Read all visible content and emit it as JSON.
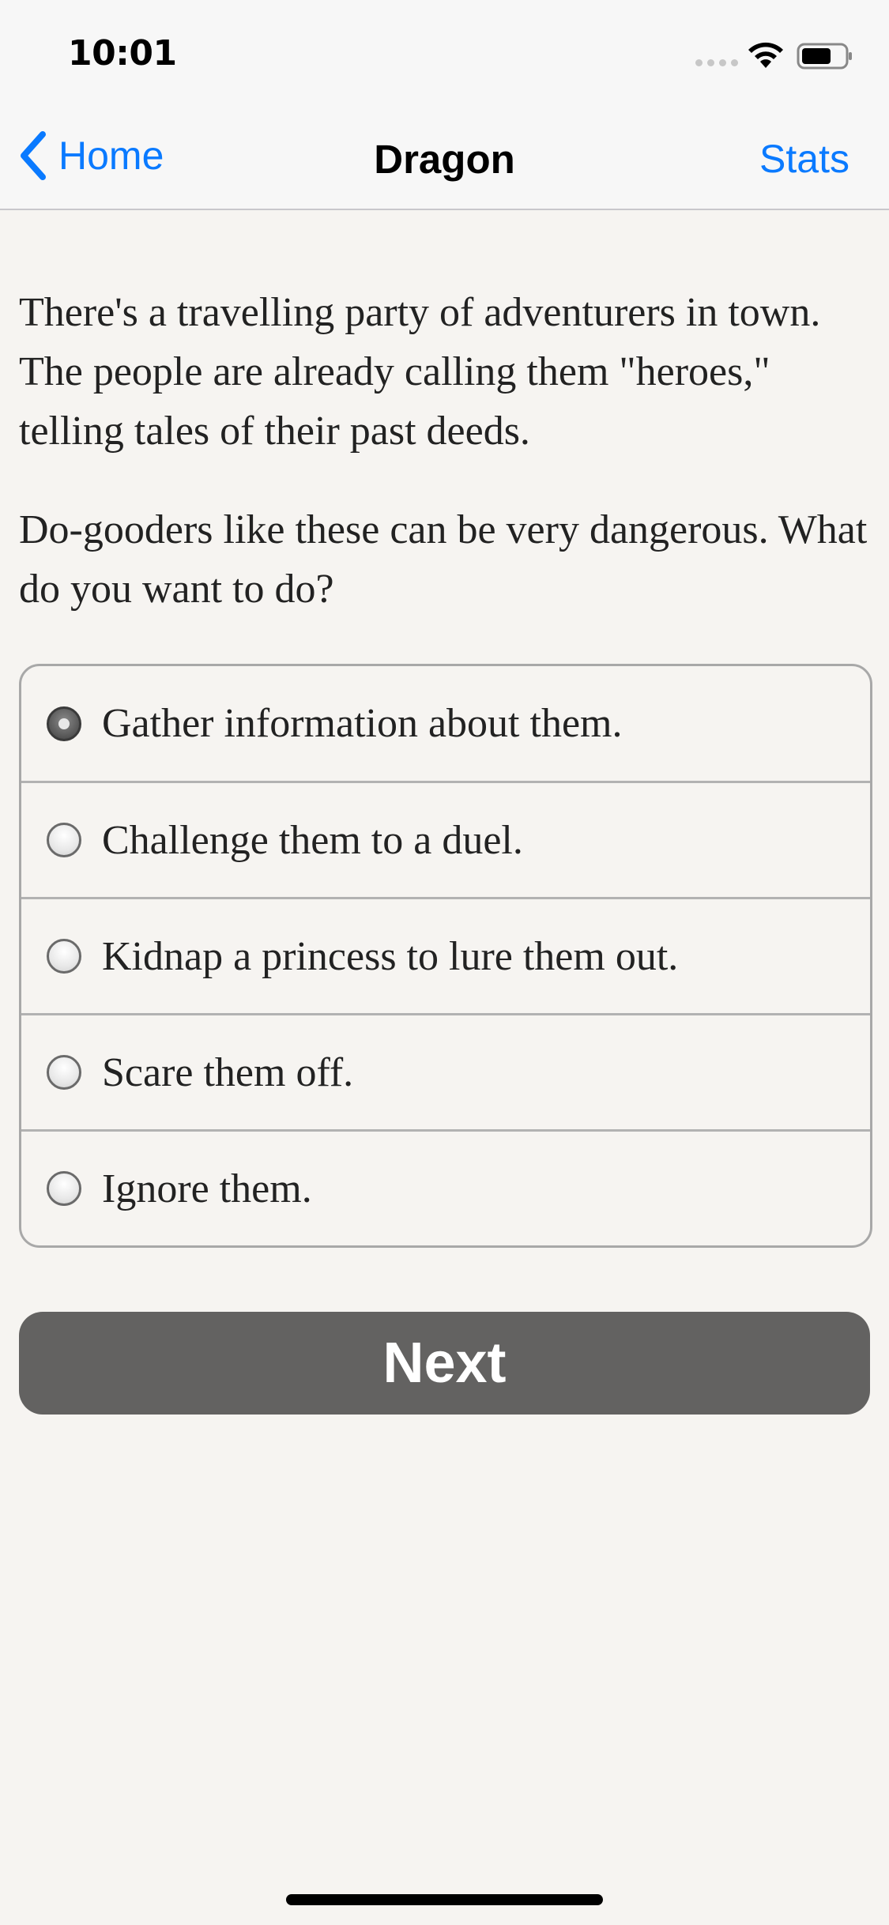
{
  "status_bar": {
    "time": "10:01",
    "icons": [
      "signal-dots-icon",
      "wifi-icon",
      "battery-icon"
    ]
  },
  "nav": {
    "back_label": "Home",
    "title": "Dragon",
    "right_label": "Stats",
    "accent_color": "#0a7aff"
  },
  "story": {
    "paragraphs": [
      "There's a travelling party of adventurers in town. The people are already calling them \"heroes,\" telling tales of their past deeds.",
      "Do-gooders like these can be very dangerous. What do you want to do?"
    ]
  },
  "choices": {
    "selected_index": 0,
    "items": [
      {
        "label": "Gather information about them.",
        "selected": true
      },
      {
        "label": "Challenge them to a duel.",
        "selected": false
      },
      {
        "label": "Kidnap a princess to lure them out.",
        "selected": false
      },
      {
        "label": "Scare them off.",
        "selected": false
      },
      {
        "label": "Ignore them.",
        "selected": false
      }
    ]
  },
  "next_button": {
    "label": "Next",
    "color": "#636261"
  }
}
